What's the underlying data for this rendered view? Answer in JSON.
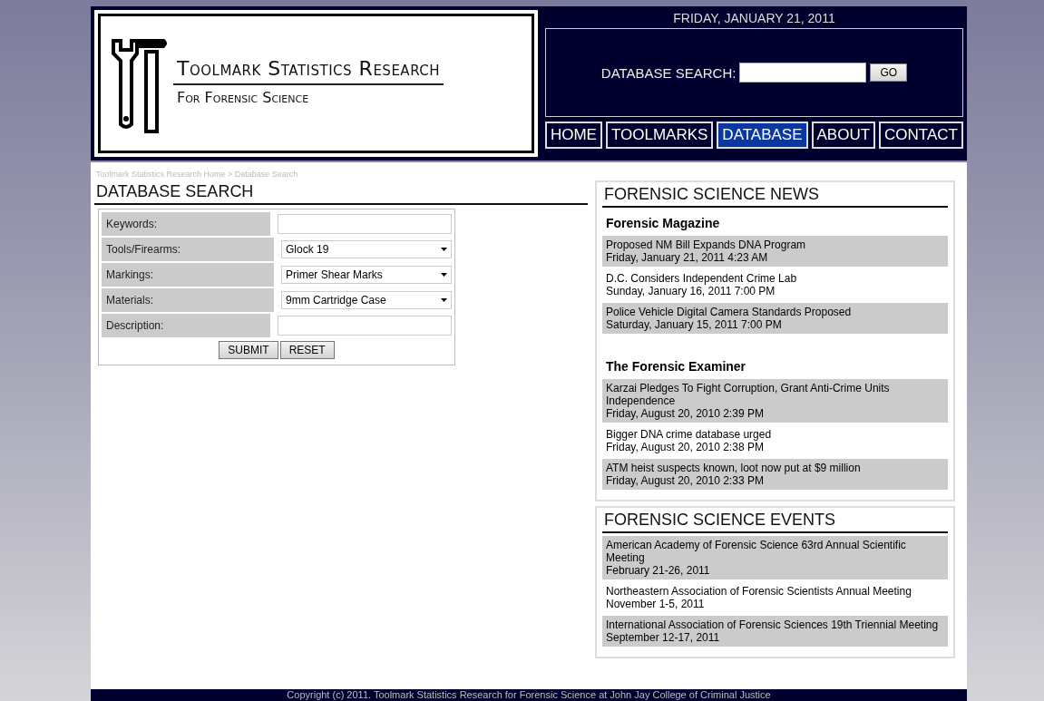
{
  "logo": {
    "title": "Toolmark Statistics Research",
    "subtitle": "For Forensic Science"
  },
  "header": {
    "date": "FRIDAY, JANUARY 21, 2011",
    "search_label": "DATABASE SEARCH:",
    "search_button": "GO"
  },
  "nav": [
    {
      "label": "HOME",
      "selected": false
    },
    {
      "label": "TOOLMARKS",
      "selected": false
    },
    {
      "label": "DATABASE",
      "selected": true
    },
    {
      "label": "ABOUT",
      "selected": false
    },
    {
      "label": "CONTACT",
      "selected": false
    }
  ],
  "breadcrumb": "Toolmark Statistics Research Home > Database Search",
  "search_form": {
    "title": "DATABASE SEARCH",
    "fields": [
      {
        "label": "Keywords:",
        "kind": "text"
      },
      {
        "label": "Tools/Firearms:",
        "kind": "select",
        "value": "Glock 19"
      },
      {
        "label": "Markings:",
        "kind": "select",
        "value": "Primer Shear Marks"
      },
      {
        "label": "Materials:",
        "kind": "select",
        "value": "9mm Cartridge Case"
      },
      {
        "label": "Description:",
        "kind": "text"
      }
    ],
    "buttons": [
      "SUBMIT",
      "RESET"
    ]
  },
  "news": {
    "title": "FORENSIC SCIENCE NEWS",
    "sources": [
      {
        "name": "Forensic Magazine",
        "items": [
          {
            "headline": "Proposed NM Bill Expands DNA Program",
            "date": "Friday, January 21, 2011 4:23 AM"
          },
          {
            "headline": "D.C. Considers Independent Crime Lab",
            "date": "Sunday, January 16, 2011 7:00 PM"
          },
          {
            "headline": "Police Vehicle Digital Camera Standards Proposed",
            "date": "Saturday, January 15, 2011 7:00 PM"
          }
        ]
      },
      {
        "name": "The Forensic Examiner",
        "items": [
          {
            "headline": "Karzai Pledges To Fight Corruption, Grant Anti-Crime Units Independence",
            "date": "Friday, August 20, 2010 2:39 PM"
          },
          {
            "headline": "Bigger DNA crime database urged",
            "date": "Friday, August 20, 2010 2:38 PM"
          },
          {
            "headline": "ATM heist suspects known, loot now put at $9 million",
            "date": "Friday, August 20, 2010 2:33 PM"
          }
        ]
      }
    ]
  },
  "events": {
    "title": "FORENSIC SCIENCE EVENTS",
    "items": [
      {
        "name": "American Academy of Forensic Science 63rd Annual Scientific Meeting",
        "date": "February 21-26, 2011"
      },
      {
        "name": "Northeastern Association of Forensic Scientists Annual Meeting",
        "date": "November 1-5, 2011"
      },
      {
        "name": "International Association of Forensic Sciences 19th Triennial Meeting",
        "date": "September 12-17, 2011"
      }
    ]
  },
  "footer": "Copyright (c) 2011. Toolmark Statistics Research for Forensic Science at John Jay College of Criminal Justice"
}
